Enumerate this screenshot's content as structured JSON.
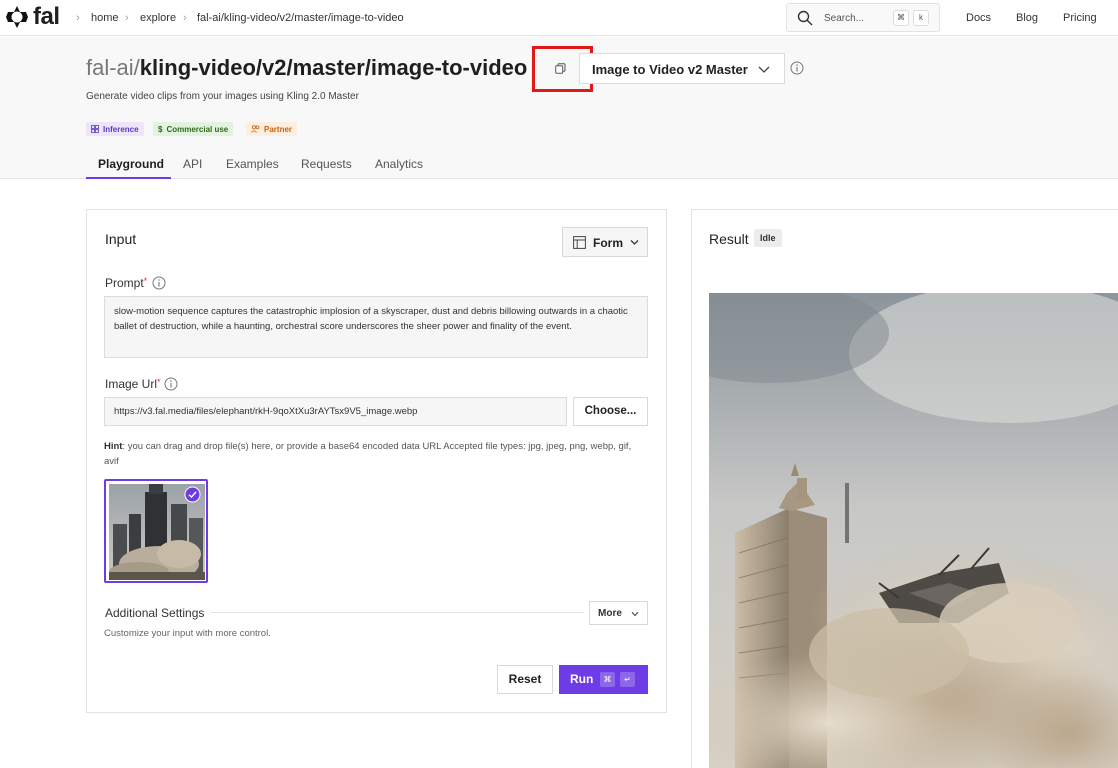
{
  "nav": {
    "logo_text": "fal",
    "breadcrumbs": [
      "home",
      "explore",
      "fal-ai/kling-video/v2/master/image-to-video"
    ],
    "search_placeholder": "Search...",
    "search_keys": [
      "⌘",
      "k"
    ],
    "links": [
      "Docs",
      "Blog",
      "Pricing"
    ]
  },
  "header": {
    "model_prefix": "fal-ai/",
    "model_name": "kling-video/v2/master/image-to-video",
    "variant_selected": "Image to Video v2 Master",
    "subtitle": "Generate video clips from your images using Kling 2.0 Master",
    "badges": [
      "Inference",
      "Commercial use",
      "Partner"
    ],
    "tabs": [
      "Playground",
      "API",
      "Examples",
      "Requests",
      "Analytics"
    ],
    "active_tab": "Playground"
  },
  "input": {
    "title": "Input",
    "view_mode": "Form",
    "prompt_label": "Prompt",
    "prompt_value": "slow-motion sequence captures the catastrophic implosion of a skyscraper, dust and debris billowing outwards in a chaotic ballet of destruction, while a haunting, orchestral score underscores the sheer power and finality of the event.",
    "image_url_label": "Image Url",
    "image_url_value": "https://v3.fal.media/files/elephant/rkH-9qoXtXu3rAYTsx9V5_image.webp",
    "choose_label": "Choose...",
    "hint_bold": "Hint",
    "hint_text": ": you can drag and drop file(s) here, or provide a base64 encoded data URL Accepted file types: jpg, jpeg, png, webp, gif, avif",
    "additional_settings_label": "Additional Settings",
    "more_label": "More",
    "settings_desc": "Customize your input with more control.",
    "reset_label": "Reset",
    "run_label": "Run",
    "run_keys": [
      "⌘",
      "↵"
    ]
  },
  "result": {
    "title": "Result",
    "status": "Idle"
  },
  "colors": {
    "accent": "#6d3ce6",
    "highlight": "#e01818"
  }
}
